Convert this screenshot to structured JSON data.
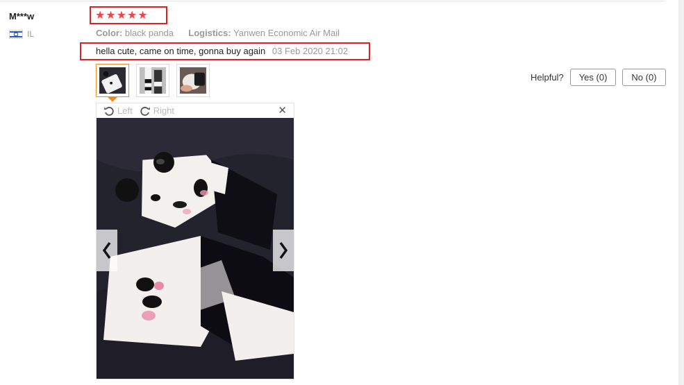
{
  "review": {
    "user_name": "M***w",
    "country_code": "IL",
    "rating_stars": 5,
    "rating_max": 5,
    "star_color": "#f0444b",
    "color_label": "Color:",
    "color_value": "black panda",
    "logistics_label": "Logistics:",
    "logistics_value": "Yanwen Economic Air Mail",
    "comment": "hella cute, came on time, gonna buy again",
    "date": "03 Feb 2020 21:02"
  },
  "images": {
    "thumbnails": [
      "thumb-1",
      "thumb-2",
      "thumb-3"
    ],
    "selected_index": 0
  },
  "viewer": {
    "rotate_left_label": "Left",
    "rotate_right_label": "Right",
    "close_icon": "close-icon",
    "prev_icon": "chevron-left-icon",
    "next_icon": "chevron-right-icon"
  },
  "helpful": {
    "label": "Helpful?",
    "yes_label": "Yes (0)",
    "no_label": "No (0)"
  },
  "colors": {
    "highlight_border": "#e02020",
    "active_thumb_border": "#f08a24"
  }
}
